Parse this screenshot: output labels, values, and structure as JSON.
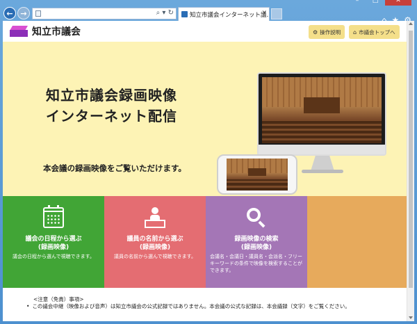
{
  "browser": {
    "address_text": "",
    "tab_title": "知立市議会インターネット議...",
    "tools_icons": [
      "home-icon",
      "star-icon",
      "gear-icon"
    ]
  },
  "header": {
    "site_title": "知立市議会",
    "help_label": "操作説明",
    "top_label": "市議会トップへ"
  },
  "hero": {
    "title_line1": "知立市議会録画映像",
    "title_line2": "インターネット配信",
    "subtitle": "本会議の録画映像をご覧いただけます。"
  },
  "tiles": [
    {
      "title_line1": "議会の日程から選ぶ",
      "title_line2": "(録画映像)",
      "description": "議会の日程から選んで視聴できます。",
      "color": "#41a536",
      "icon": "calendar-icon"
    },
    {
      "title_line1": "議員の名前から選ぶ",
      "title_line2": "(録画映像)",
      "description": "議員の名前から選んで視聴できます。",
      "color": "#e46d72",
      "icon": "speaker-icon"
    },
    {
      "title_line1": "録画映像の検索",
      "title_line2": "(録画映像)",
      "description": "会議名・会議日・議員名・会派名・フリーキーワードの条件で映像を検索することができます。",
      "color": "#a476b6",
      "icon": "search-icon"
    },
    {
      "title_line1": "",
      "title_line2": "",
      "description": "",
      "color": "#e7aa5c",
      "icon": ""
    }
  ],
  "notice": {
    "heading": "<注意（免責）事項>",
    "item1": "この議会中継（映像および音声）は知立市議会の公式記録ではありません。本会議の公式な記録は、本会議録（文字）をご覧ください。"
  }
}
